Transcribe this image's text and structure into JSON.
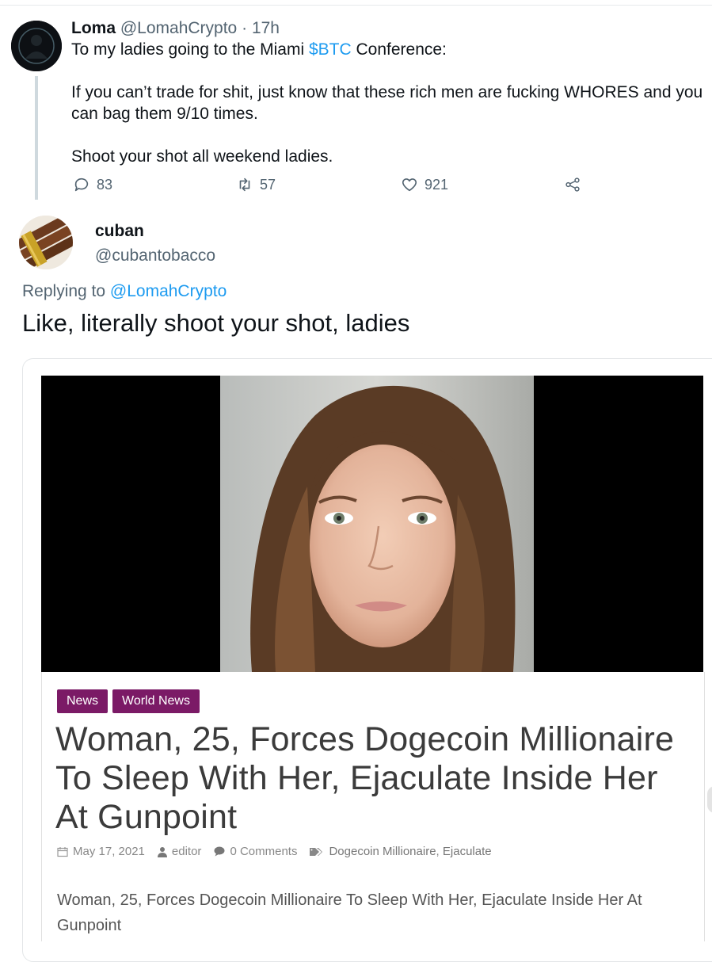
{
  "tweet1": {
    "display_name": "Loma",
    "handle": "@LomahCrypto",
    "separator": "·",
    "time": "17h",
    "line1_prefix": "To my ladies going to the Miami ",
    "line1_cashtag": "$BTC",
    "line1_suffix": " Conference:",
    "paragraph2": "If you can’t trade for shit, just know that these rich men are fucking WHORES and you can bag them 9/10 times.",
    "paragraph3": "Shoot your shot all weekend ladies.",
    "replies": "83",
    "retweets": "57",
    "likes": "921",
    "icons": [
      "reply-icon",
      "retweet-icon",
      "like-icon",
      "share-icon"
    ]
  },
  "tweet2": {
    "display_name": "cuban",
    "handle": "@cubantobacco",
    "replying_prefix": "Replying to ",
    "replying_handle": "@LomahCrypto",
    "text": "Like, literally shoot your shot, ladies"
  },
  "article_card": {
    "tags": [
      "News",
      "World News"
    ],
    "headline": "Woman, 25, Forces Dogecoin Millionaire To Sleep With Her, Ejaculate Inside Her At Gunpoint",
    "date": "May 17, 2021",
    "author": "editor",
    "comments": "0 Comments",
    "categories": [
      "Dogecoin Millionaire",
      "Ejaculate"
    ],
    "category_separator": ", ",
    "excerpt": "Woman, 25, Forces Dogecoin Millionaire To Sleep With Her, Ejaculate Inside Her At Gunpoint"
  },
  "colors": {
    "link_blue": "#1d9bf0",
    "muted_gray": "#536471",
    "tag_purple": "#7b1a66",
    "headline_gray": "#3b3b3b"
  }
}
